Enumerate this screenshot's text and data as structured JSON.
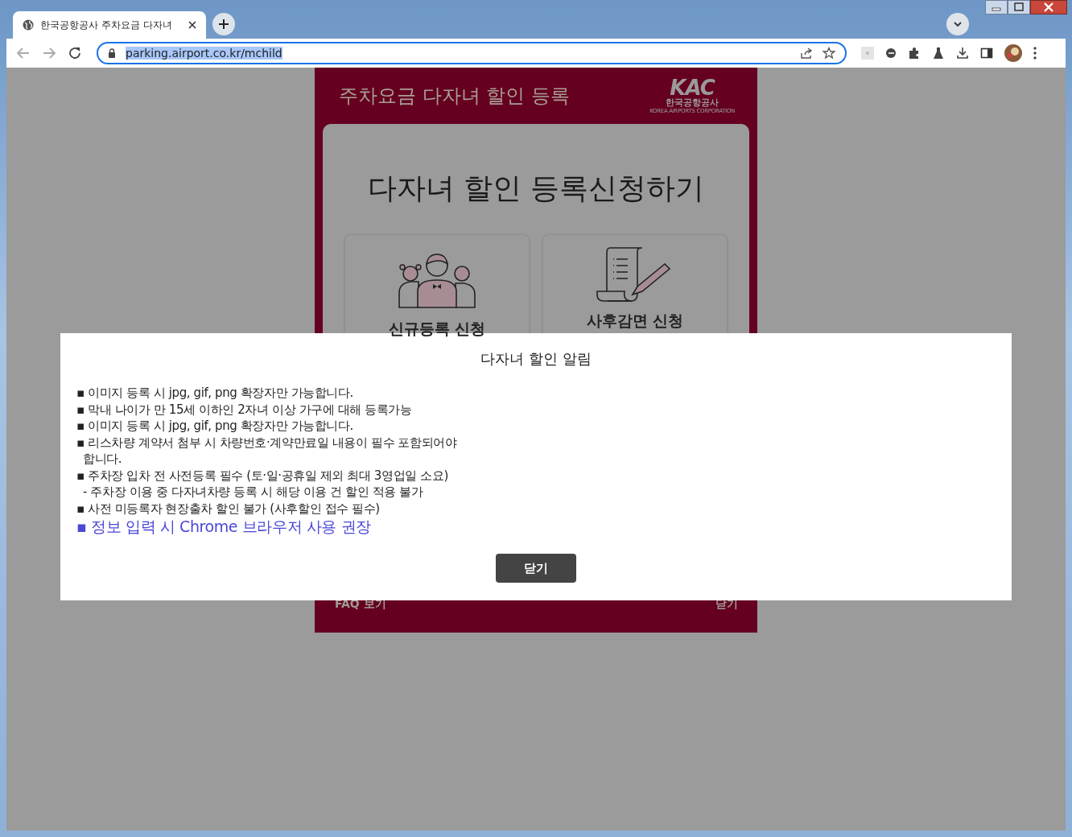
{
  "browser": {
    "tabs": [
      {
        "title": "한국공항공사 주차요금 다자녀",
        "selected": true
      }
    ],
    "address": {
      "url": "parking.airport.co.kr/mchild"
    }
  },
  "page": {
    "header_title": "주차요금 다자녀 할인 등록",
    "logo": {
      "mark": "KAC",
      "name": "한국공항공사",
      "tagline": "KOREA AIRPORTS CORPORATION"
    },
    "heading": "다자녀 할인 등록신청하기",
    "options": [
      {
        "label": "신규등록 신청",
        "kind": "family"
      },
      {
        "label": "사후감면 신청",
        "kind": "document"
      }
    ],
    "footer": {
      "faq": "FAQ 보기",
      "close": "닫기"
    }
  },
  "modal": {
    "title": "다자녀 할인 알림",
    "notices": [
      {
        "text": "▪ 이미지 등록 시 jpg, gif, png 확장자만 가능합니다.",
        "kind": "bullet"
      },
      {
        "text": "▪ 막내 나이가 만 15세 이하인 2자녀 이상 가구에 대해 등록가능",
        "kind": "bullet"
      },
      {
        "text": "▪ 이미지 등록 시 jpg, gif, png 확장자만 가능합니다.",
        "kind": "bullet"
      },
      {
        "text": "▪ 리스차량 계약서 첨부 시 차량번호·계약만료일 내용이 필수 포함되어야",
        "kind": "bullet"
      },
      {
        "text": "합니다.",
        "kind": "continuation"
      },
      {
        "text": "▪ 주차장 입차 전 사전등록 필수 (토·일·공휴일 제외 최대 3영업일 소요)",
        "kind": "bullet"
      },
      {
        "text": "- 주차장 이용 중 다자녀차량 등록 시 해당 이용 건 할인 적용 불가",
        "kind": "continuation"
      },
      {
        "text": "▪ 사전 미등록자 현장출차 할인 불가 (사후할인 접수 필수)",
        "kind": "bullet"
      },
      {
        "text": "▪ 정보 입력 시 Chrome 브라우저 사용 권장",
        "kind": "highlight"
      }
    ],
    "button": "닫기"
  }
}
